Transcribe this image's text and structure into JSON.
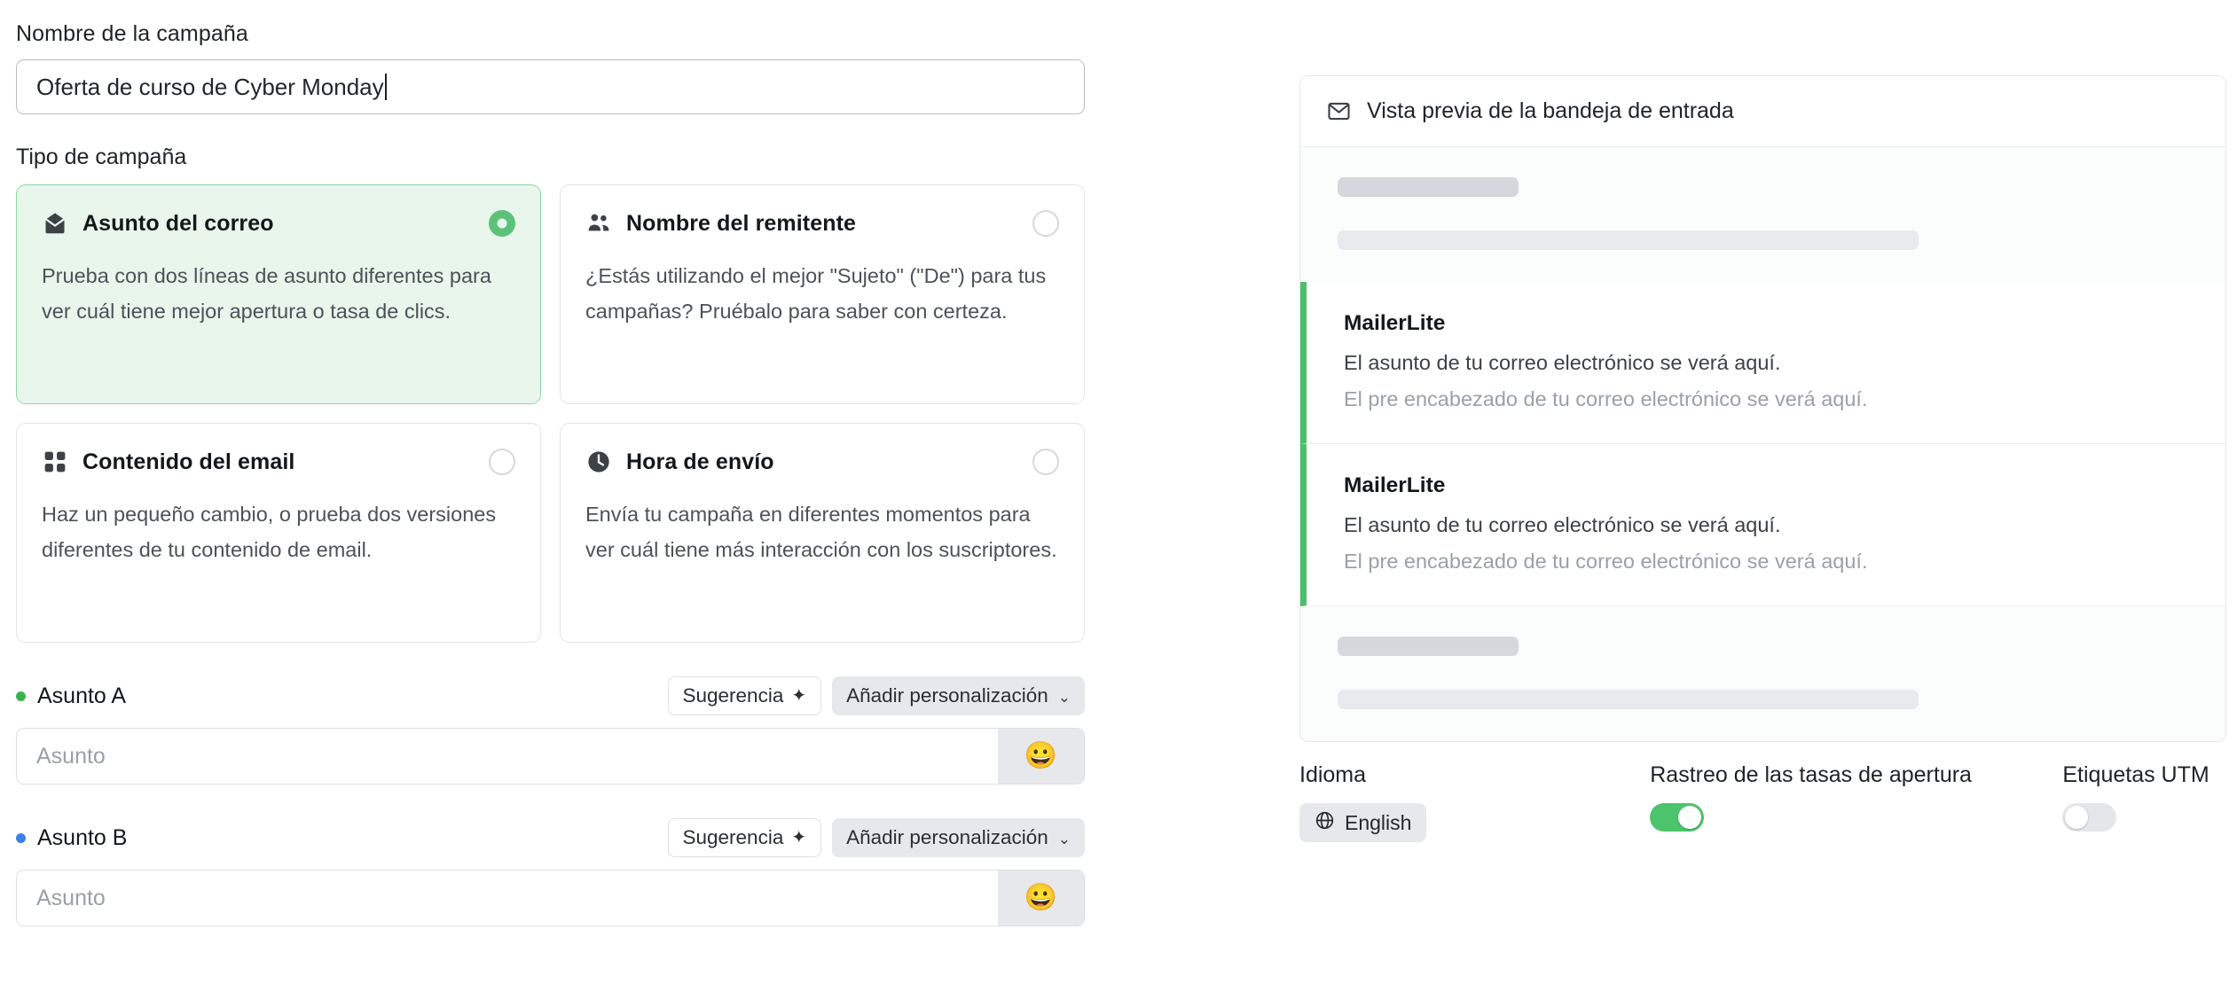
{
  "form": {
    "campaign_name_label": "Nombre de la campaña",
    "campaign_name_value": "Oferta de curso de Cyber Monday",
    "campaign_type_label": "Tipo de campaña"
  },
  "campaign_types": [
    {
      "title": "Asunto del correo",
      "description": "Prueba con dos líneas de asunto diferentes para ver cuál tiene mejor apertura o tasa de clics.",
      "icon": "envelope-open-icon",
      "selected": true
    },
    {
      "title": "Nombre del remitente",
      "description": "¿Estás utilizando el mejor \"Sujeto\" (\"De\") para tus campañas? Pruébalo para saber con certeza.",
      "icon": "users-icon",
      "selected": false
    },
    {
      "title": "Contenido del email",
      "description": "Haz un pequeño cambio, o prueba dos versiones diferentes de tu contenido de email.",
      "icon": "grid-icon",
      "selected": false
    },
    {
      "title": "Hora de envío",
      "description": "Envía tu campaña en diferentes momentos para ver cuál tiene más interacción con los suscriptores.",
      "icon": "clock-icon",
      "selected": false
    }
  ],
  "subjects": [
    {
      "label": "Asunto A",
      "dot_color": "#3cb24e",
      "suggest_label": "Sugerencia",
      "suggest_icon": "sparkles-icon",
      "personalize_label": "Añadir personalización",
      "personalize_icon": "chevron-down-icon",
      "input_placeholder": "Asunto",
      "input_value": "",
      "emoji_icon": "grinning-face-icon",
      "emoji_glyph": "😀"
    },
    {
      "label": "Asunto B",
      "dot_color": "#3d7fe8",
      "suggest_label": "Sugerencia",
      "suggest_icon": "sparkles-icon",
      "personalize_label": "Añadir personalización",
      "personalize_icon": "chevron-down-icon",
      "input_placeholder": "Asunto",
      "input_value": "",
      "emoji_icon": "grinning-face-icon",
      "emoji_glyph": "😀"
    }
  ],
  "preview": {
    "header_title": "Vista previa de la bandeja de entrada",
    "header_icon": "envelope-icon",
    "items": [
      {
        "sender": "MailerLite",
        "subject": "El asunto de tu correo electrónico se verá aquí.",
        "preheader": "El pre encabezado de tu correo electrónico se verá aquí.",
        "accent_color": "#4cbf6e"
      },
      {
        "sender": "MailerLite",
        "subject": "El asunto de tu correo electrónico se verá aquí.",
        "preheader": "El pre encabezado de tu correo electrónico se verá aquí.",
        "accent_color": "#4cbf6e"
      }
    ]
  },
  "settings": {
    "language_label": "Idioma",
    "language_value": "English",
    "language_icon": "globe-icon",
    "open_tracking_label": "Rastreo de las tasas de apertura",
    "open_tracking_on": true,
    "utm_label": "Etiquetas UTM",
    "utm_on": false
  },
  "colors": {
    "accent_green": "#4cc46c",
    "selected_card_bg": "#e8f6ec",
    "selected_card_border": "#8fd6a4"
  }
}
